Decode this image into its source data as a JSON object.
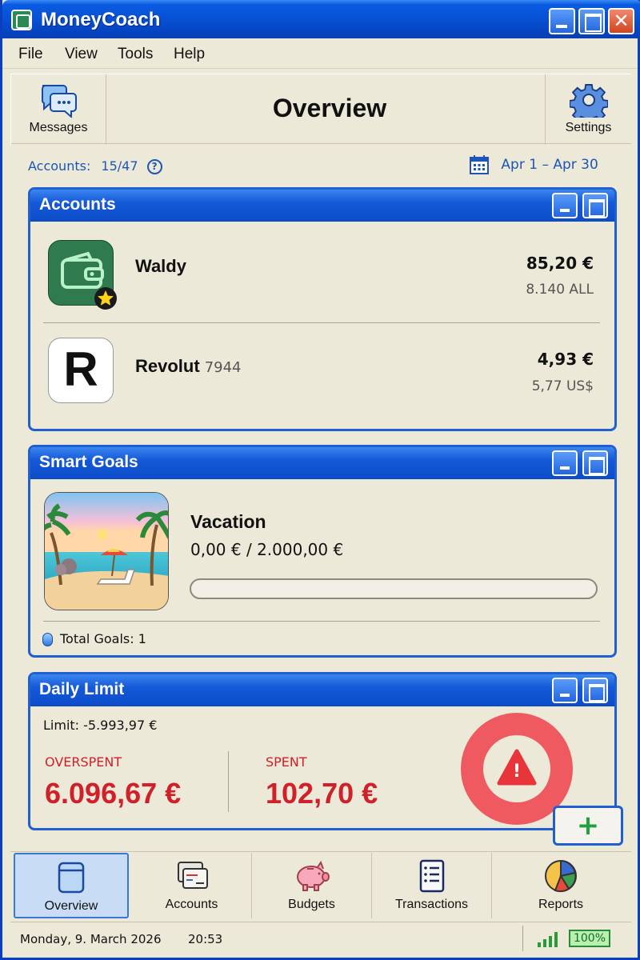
{
  "app": {
    "title": "MoneyCoach"
  },
  "menu": [
    "File",
    "View",
    "Tools",
    "Help"
  ],
  "toolbar": {
    "messages_label": "Messages",
    "settings_label": "Settings",
    "page_title": "Overview"
  },
  "filters": {
    "accounts_label": "Accounts:",
    "accounts_count": "15/47",
    "help_glyph": "?",
    "date_range": "Apr 1 – Apr 30"
  },
  "accounts_panel": {
    "title": "Accounts",
    "items": [
      {
        "name": "Waldy",
        "number": "",
        "amount": "85,20 €",
        "sub_amount": "8.140 ALL",
        "icon": "wallet-icon",
        "favorite": true
      },
      {
        "name": "Revolut",
        "number": "7944",
        "amount": "4,93 €",
        "sub_amount": "5,77 US$",
        "icon": "revolut-logo",
        "logo_letter": "R",
        "favorite": false
      }
    ]
  },
  "goals_panel": {
    "title": "Smart Goals",
    "goal": {
      "name": "Vacation",
      "amount": "0,00 € / 2.000,00 €",
      "progress": 0,
      "image": "beach-image"
    },
    "total_label": "Total  Goals: 1"
  },
  "limit_panel": {
    "title": "Daily Limit",
    "limit_text": "Limit: -5.993,97 €",
    "overspent_label": "OVERSPENT",
    "overspent_value": "6.096,67 €",
    "spent_label": "SPENT",
    "spent_value": "102,70 €",
    "alert_glyph": "!"
  },
  "fab": {
    "glyph": "+"
  },
  "nav": [
    {
      "label": "Overview",
      "icon": "overview-icon",
      "active": true
    },
    {
      "label": "Accounts",
      "icon": "accounts-icon",
      "active": false
    },
    {
      "label": "Budgets",
      "icon": "piggy-bank-icon",
      "active": false
    },
    {
      "label": "Transactions",
      "icon": "transactions-icon",
      "active": false
    },
    {
      "label": "Reports",
      "icon": "pie-chart-icon",
      "active": false
    }
  ],
  "status": {
    "date": "Monday, 9. March 2026",
    "time": "20:53",
    "battery": "100%"
  },
  "colors": {
    "accent": "#1f5fcf",
    "danger": "#d0202a",
    "success": "#2a9a5a"
  }
}
